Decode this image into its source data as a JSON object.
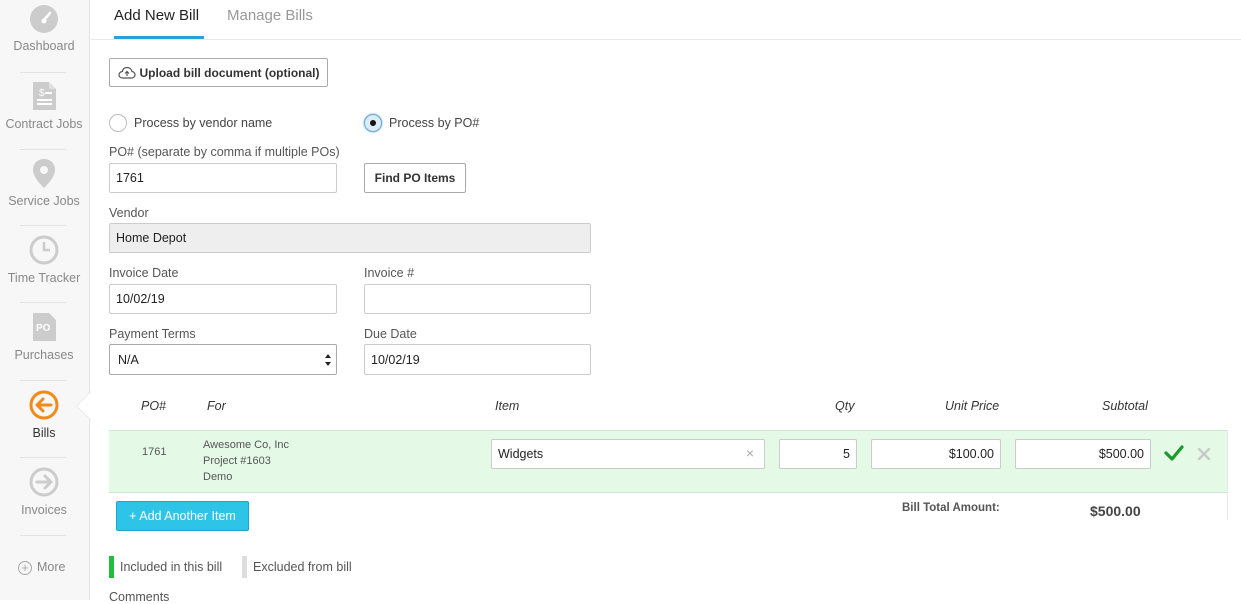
{
  "sidebar": {
    "items": [
      {
        "label": "Dashboard",
        "icon": "dashboard-icon"
      },
      {
        "label": "Contract Jobs",
        "icon": "contract-document-icon"
      },
      {
        "label": "Service Jobs",
        "icon": "location-pin-icon"
      },
      {
        "label": "Time Tracker",
        "icon": "clock-icon"
      },
      {
        "label": "Purchases",
        "icon": "po-document-icon"
      },
      {
        "label": "Bills",
        "icon": "arrow-left-circle-icon",
        "active": true
      },
      {
        "label": "Invoices",
        "icon": "arrow-right-circle-icon"
      }
    ],
    "more_label": "More",
    "active_color": "#f08a1c"
  },
  "tabs": [
    {
      "label": "Add New Bill",
      "active": true
    },
    {
      "label": "Manage Bills",
      "active": false
    }
  ],
  "upload_button_label": "Upload bill document (optional)",
  "process_options": [
    {
      "label": "Process by vendor name",
      "checked": false
    },
    {
      "label": "Process by PO#",
      "checked": true
    }
  ],
  "po_field": {
    "label": "PO# (separate by comma if multiple POs)",
    "value": "1761"
  },
  "find_po_button_label": "Find PO Items",
  "vendor": {
    "label": "Vendor",
    "value": "Home Depot"
  },
  "invoice_date": {
    "label": "Invoice Date",
    "value": "10/02/19"
  },
  "invoice_number": {
    "label": "Invoice #",
    "value": ""
  },
  "payment_terms": {
    "label": "Payment Terms",
    "value": "N/A"
  },
  "due_date": {
    "label": "Due Date",
    "value": "10/02/19"
  },
  "table": {
    "headers": [
      "PO#",
      "For",
      "Item",
      "Qty",
      "Unit Price",
      "Subtotal"
    ],
    "rows": [
      {
        "po": "1761",
        "for_lines": [
          "Awesome Co, Inc",
          "Project #1603",
          "Demo"
        ],
        "item": "Widgets",
        "qty": "5",
        "unit_price": "$100.00",
        "subtotal": "$500.00"
      }
    ]
  },
  "add_item_button_label": "+ Add Another Item",
  "total": {
    "label": "Bill Total Amount:",
    "value": "$500.00"
  },
  "legend": [
    {
      "label": "Included in this bill",
      "color": "#1fbf3c"
    },
    {
      "label": "Excluded from bill",
      "color": "#dddddd"
    }
  ],
  "comments_label": "Comments"
}
